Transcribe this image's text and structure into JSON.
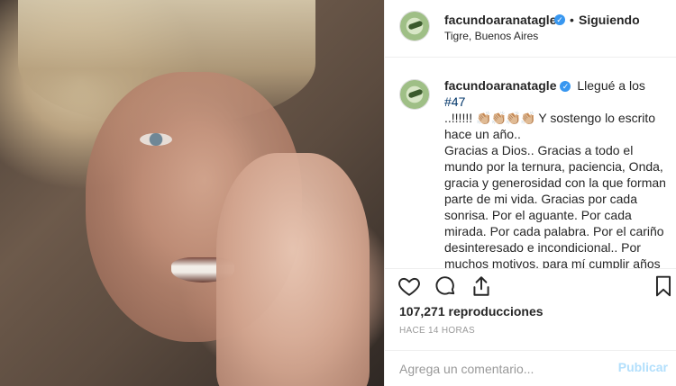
{
  "header": {
    "username": "facundoaranatagle",
    "verified_badge": "✓",
    "separator": "•",
    "follow_label": "Siguiendo",
    "location": "Tigre, Buenos Aires"
  },
  "caption": {
    "username": "facundoaranatagle",
    "verified_badge": "✓",
    "text_before_hashtag": " Llegué a los ",
    "hashtag": "#47",
    "line2_prefix": "..!!!!!! ",
    "hands": "👏🏼👏🏼👏🏼👏🏼",
    "line2_suffix": " Y sostengo lo escrito hace un año..",
    "body": "Gracias a Dios.. Gracias a todo el mundo por la ternura, paciencia, Onda, gracia y generosidad con la que forman parte de mi vida. Gracias por cada sonrisa. Por el aguante. Por cada mirada. Por cada palabra. Por el cariño desinteresado e incondicional.. Por muchos motivos, para mí cumplir años fue siempre insólitamente especial !"
  },
  "stats": {
    "views": "107,271 reproducciones",
    "time_ago": "HACE 14 HORAS"
  },
  "comment": {
    "placeholder": "Agrega un comentario...",
    "post_label": "Publicar"
  },
  "icons": {
    "like": "heart-icon",
    "comment": "comment-icon",
    "share": "share-icon",
    "save": "bookmark-icon"
  },
  "colors": {
    "verified": "#3897f0",
    "hashtag": "#003569",
    "post_button_disabled": "#b2dffc",
    "meta_text": "#999999"
  }
}
